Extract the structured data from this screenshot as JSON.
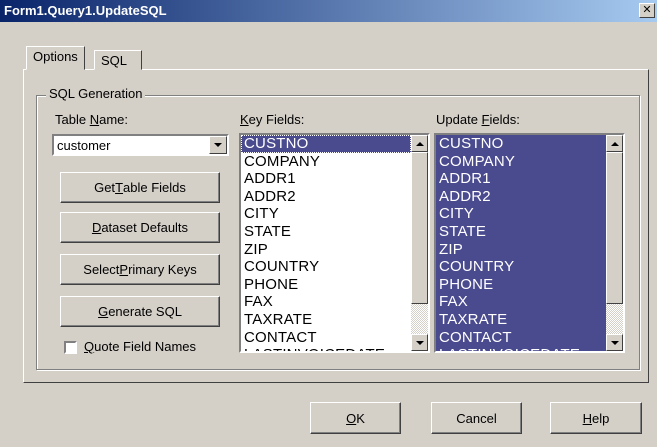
{
  "window": {
    "title": "Form1.Query1.UpdateSQL",
    "close_glyph": "✕"
  },
  "tabs": [
    {
      "label": "Options",
      "active": true
    },
    {
      "label": "SQL",
      "active": false
    }
  ],
  "group": {
    "title": "SQL Generation",
    "table_name": {
      "label_pre": "Table ",
      "label_ul": "N",
      "label_post": "ame:",
      "value": "customer"
    },
    "buttons": {
      "get_table_fields": {
        "pre": "Get ",
        "ul": "T",
        "post": "able Fields"
      },
      "dataset_defaults": {
        "pre": "",
        "ul": "D",
        "post": "ataset Defaults"
      },
      "select_primary_keys": {
        "pre": "Select ",
        "ul": "P",
        "post": "rimary Keys"
      },
      "generate_sql": {
        "pre": "",
        "ul": "G",
        "post": "enerate SQL"
      }
    },
    "quote_field_names": {
      "pre": "",
      "ul": "Q",
      "post": "uote Field Names",
      "checked": false
    },
    "key_fields": {
      "label_pre": "",
      "label_ul": "K",
      "label_post": "ey Fields:",
      "items": [
        "CUSTNO",
        "COMPANY",
        "ADDR1",
        "ADDR2",
        "CITY",
        "STATE",
        "ZIP",
        "COUNTRY",
        "PHONE",
        "FAX",
        "TAXRATE",
        "CONTACT",
        "LASTINVOICEDATE"
      ],
      "selected": [
        "CUSTNO"
      ]
    },
    "update_fields": {
      "label_pre": "Update ",
      "label_ul": "F",
      "label_post": "ields:",
      "items": [
        "CUSTNO",
        "COMPANY",
        "ADDR1",
        "ADDR2",
        "CITY",
        "STATE",
        "ZIP",
        "COUNTRY",
        "PHONE",
        "FAX",
        "TAXRATE",
        "CONTACT",
        "LASTINVOICEDATE"
      ],
      "selected": "all"
    }
  },
  "footer": {
    "ok": {
      "pre": "",
      "ul": "O",
      "post": "K"
    },
    "cancel": {
      "pre": "Cancel",
      "ul": "",
      "post": ""
    },
    "help": {
      "pre": "",
      "ul": "H",
      "post": "elp"
    }
  },
  "colors": {
    "selection": "#4a4a8f",
    "titlebar": "#0a246a",
    "face": "#d4d0c8"
  }
}
